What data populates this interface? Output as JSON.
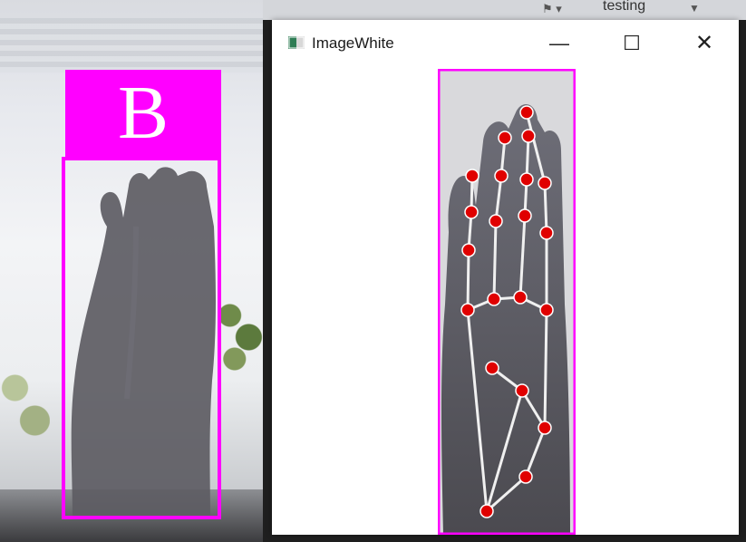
{
  "webcam": {
    "prediction_label": "B",
    "box_color": "#ff00ff"
  },
  "taskbar": {
    "item_text": "testing",
    "dropdown_glyph": "▼"
  },
  "window": {
    "title": "ImageWhite",
    "controls": {
      "minimize": "—",
      "maximize": "☐",
      "close": "✕"
    }
  },
  "landmarks": {
    "point_color": "#e00000",
    "line_color": "#f0f0f0",
    "box_color": "#ff00ff"
  }
}
